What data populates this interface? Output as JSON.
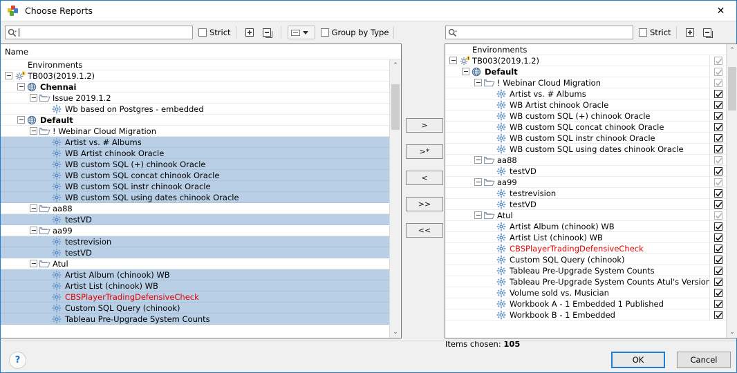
{
  "window": {
    "title": "Choose Reports",
    "close_label": "✕",
    "app_icon": "tableau-reports-icon"
  },
  "left_toolbar": {
    "search_placeholder": "",
    "search_value": "",
    "search_icon": "search-icon",
    "strict_label": "Strict",
    "strict_checked": false,
    "expand_all_icon": "expand-all-icon",
    "collapse_all_icon": "collapse-all-icon",
    "group_combo_icon": "group-level-icon",
    "group_by_type_label": "Group by Type",
    "group_by_type_checked": false
  },
  "right_toolbar": {
    "search_placeholder": "",
    "search_value": "",
    "search_icon": "search-icon",
    "strict_label": "Strict",
    "strict_checked": false,
    "expand_all_icon": "expand-all-icon",
    "collapse_all_icon": "collapse-all-icon"
  },
  "left_panel": {
    "column_header": "Name",
    "rows": [
      {
        "label": "Environments",
        "depth": 0,
        "icon": "none",
        "expander": "none",
        "selected": false,
        "bold": false,
        "red": false
      },
      {
        "label": "TB003(2019.1.2)",
        "depth": 0,
        "icon": "server",
        "expander": "minus",
        "selected": false,
        "bold": false,
        "red": false
      },
      {
        "label": "Chennai",
        "depth": 1,
        "icon": "site",
        "expander": "minus",
        "selected": false,
        "bold": true,
        "red": false
      },
      {
        "label": "Issue 2019.1.2",
        "depth": 2,
        "icon": "folder",
        "expander": "minus",
        "selected": false,
        "bold": false,
        "red": false
      },
      {
        "label": "Wb based on Postgres - embedded",
        "depth": 3,
        "icon": "workbook",
        "expander": "none",
        "selected": false,
        "bold": false,
        "red": false
      },
      {
        "label": "Default",
        "depth": 1,
        "icon": "site",
        "expander": "minus",
        "selected": false,
        "bold": true,
        "red": false
      },
      {
        "label": "! Webinar Cloud Migration",
        "depth": 2,
        "icon": "folder",
        "expander": "minus",
        "selected": false,
        "bold": false,
        "red": false
      },
      {
        "label": "Artist vs. # Albums",
        "depth": 3,
        "icon": "workbook",
        "expander": "none",
        "selected": true,
        "bold": false,
        "red": false
      },
      {
        "label": "WB Artist chinook Oracle",
        "depth": 3,
        "icon": "workbook",
        "expander": "none",
        "selected": true,
        "bold": false,
        "red": false
      },
      {
        "label": "WB custom SQL (+) chinook Oracle",
        "depth": 3,
        "icon": "workbook",
        "expander": "none",
        "selected": true,
        "bold": false,
        "red": false
      },
      {
        "label": "WB custom SQL concat chinook Oracle",
        "depth": 3,
        "icon": "workbook",
        "expander": "none",
        "selected": true,
        "bold": false,
        "red": false
      },
      {
        "label": "WB custom SQL instr chinook Oracle",
        "depth": 3,
        "icon": "workbook",
        "expander": "none",
        "selected": true,
        "bold": false,
        "red": false
      },
      {
        "label": "WB custom SQL using dates chinook Oracle",
        "depth": 3,
        "icon": "workbook",
        "expander": "none",
        "selected": true,
        "bold": false,
        "red": false
      },
      {
        "label": "aa88",
        "depth": 2,
        "icon": "folder",
        "expander": "minus",
        "selected": false,
        "bold": false,
        "red": false
      },
      {
        "label": "testVD",
        "depth": 3,
        "icon": "workbook",
        "expander": "none",
        "selected": true,
        "bold": false,
        "red": false
      },
      {
        "label": "aa99",
        "depth": 2,
        "icon": "folder",
        "expander": "minus",
        "selected": false,
        "bold": false,
        "red": false
      },
      {
        "label": "testrevision",
        "depth": 3,
        "icon": "workbook",
        "expander": "none",
        "selected": true,
        "bold": false,
        "red": false
      },
      {
        "label": "testVD",
        "depth": 3,
        "icon": "workbook",
        "expander": "none",
        "selected": true,
        "bold": false,
        "red": false
      },
      {
        "label": "Atul",
        "depth": 2,
        "icon": "folder",
        "expander": "minus",
        "selected": false,
        "bold": false,
        "red": false
      },
      {
        "label": "Artist Album (chinook) WB",
        "depth": 3,
        "icon": "workbook",
        "expander": "none",
        "selected": true,
        "bold": false,
        "red": false
      },
      {
        "label": "Artist List (chinook) WB",
        "depth": 3,
        "icon": "workbook",
        "expander": "none",
        "selected": true,
        "bold": false,
        "red": false
      },
      {
        "label": "CBSPlayerTradingDefensiveCheck",
        "depth": 3,
        "icon": "workbook",
        "expander": "none",
        "selected": true,
        "bold": false,
        "red": true
      },
      {
        "label": "Custom SQL  Query (chinook)",
        "depth": 3,
        "icon": "workbook",
        "expander": "none",
        "selected": true,
        "bold": false,
        "red": false
      },
      {
        "label": "Tableau Pre-Upgrade System Counts",
        "depth": 3,
        "icon": "workbook",
        "expander": "none",
        "selected": true,
        "bold": false,
        "red": false
      }
    ],
    "scrollbar": {
      "up_arrow": "⌃",
      "down_arrow": "⌄",
      "thumb_top_pct": 5,
      "thumb_height_pct": 18
    }
  },
  "right_panel": {
    "rows": [
      {
        "label": "Environments",
        "depth": 0,
        "icon": "none",
        "expander": "none",
        "checkbox": "none",
        "red": false,
        "bold": false
      },
      {
        "label": "TB003(2019.1.2)",
        "depth": 0,
        "icon": "server",
        "expander": "minus",
        "checkbox": "dim",
        "red": false,
        "bold": false
      },
      {
        "label": "Default",
        "depth": 1,
        "icon": "site",
        "expander": "minus",
        "checkbox": "dim",
        "red": false,
        "bold": true
      },
      {
        "label": "! Webinar Cloud Migration",
        "depth": 2,
        "icon": "folder",
        "expander": "minus",
        "checkbox": "dim",
        "red": false,
        "bold": false
      },
      {
        "label": "Artist vs. # Albums",
        "depth": 3,
        "icon": "workbook",
        "expander": "none",
        "checkbox": "checked",
        "red": false,
        "bold": false
      },
      {
        "label": "WB Artist chinook Oracle",
        "depth": 3,
        "icon": "workbook",
        "expander": "none",
        "checkbox": "checked",
        "red": false,
        "bold": false
      },
      {
        "label": "WB custom SQL (+) chinook Oracle",
        "depth": 3,
        "icon": "workbook",
        "expander": "none",
        "checkbox": "checked",
        "red": false,
        "bold": false
      },
      {
        "label": "WB custom SQL concat chinook Oracle",
        "depth": 3,
        "icon": "workbook",
        "expander": "none",
        "checkbox": "checked",
        "red": false,
        "bold": false
      },
      {
        "label": "WB custom SQL instr chinook Oracle",
        "depth": 3,
        "icon": "workbook",
        "expander": "none",
        "checkbox": "checked",
        "red": false,
        "bold": false
      },
      {
        "label": "WB custom SQL using dates chinook Oracle",
        "depth": 3,
        "icon": "workbook",
        "expander": "none",
        "checkbox": "checked",
        "red": false,
        "bold": false
      },
      {
        "label": "aa88",
        "depth": 2,
        "icon": "folder",
        "expander": "minus",
        "checkbox": "dim",
        "red": false,
        "bold": false
      },
      {
        "label": "testVD",
        "depth": 3,
        "icon": "workbook",
        "expander": "none",
        "checkbox": "checked",
        "red": false,
        "bold": false
      },
      {
        "label": "aa99",
        "depth": 2,
        "icon": "folder",
        "expander": "minus",
        "checkbox": "dim",
        "red": false,
        "bold": false
      },
      {
        "label": "testrevision",
        "depth": 3,
        "icon": "workbook",
        "expander": "none",
        "checkbox": "checked",
        "red": false,
        "bold": false
      },
      {
        "label": "testVD",
        "depth": 3,
        "icon": "workbook",
        "expander": "none",
        "checkbox": "checked",
        "red": false,
        "bold": false
      },
      {
        "label": "Atul",
        "depth": 2,
        "icon": "folder",
        "expander": "minus",
        "checkbox": "dim",
        "red": false,
        "bold": false
      },
      {
        "label": "Artist Album (chinook) WB",
        "depth": 3,
        "icon": "workbook",
        "expander": "none",
        "checkbox": "checked",
        "red": false,
        "bold": false
      },
      {
        "label": "Artist List (chinook) WB",
        "depth": 3,
        "icon": "workbook",
        "expander": "none",
        "checkbox": "checked",
        "red": false,
        "bold": false
      },
      {
        "label": "CBSPlayerTradingDefensiveCheck",
        "depth": 3,
        "icon": "workbook",
        "expander": "none",
        "checkbox": "checked",
        "red": true,
        "bold": false
      },
      {
        "label": "Custom SQL  Query (chinook)",
        "depth": 3,
        "icon": "workbook",
        "expander": "none",
        "checkbox": "checked",
        "red": false,
        "bold": false
      },
      {
        "label": "Tableau Pre-Upgrade System Counts",
        "depth": 3,
        "icon": "workbook",
        "expander": "none",
        "checkbox": "checked",
        "red": false,
        "bold": false
      },
      {
        "label": "Tableau Pre-Upgrade System Counts Atul's Version",
        "depth": 3,
        "icon": "workbook",
        "expander": "none",
        "checkbox": "checked",
        "red": false,
        "bold": false
      },
      {
        "label": "Volume sold vs. Musician",
        "depth": 3,
        "icon": "workbook",
        "expander": "none",
        "checkbox": "checked",
        "red": false,
        "bold": false
      },
      {
        "label": "Workbook A - 1 Embedded 1 Published",
        "depth": 3,
        "icon": "workbook",
        "expander": "none",
        "checkbox": "checked",
        "red": false,
        "bold": false
      },
      {
        "label": "Workbook B - 1 Embedded",
        "depth": 3,
        "icon": "workbook",
        "expander": "none",
        "checkbox": "checked",
        "red": false,
        "bold": false
      }
    ],
    "scrollbar": {
      "up_arrow": "⌃",
      "down_arrow": "⌄",
      "thumb_top_pct": 4,
      "thumb_height_pct": 16
    }
  },
  "transfer_buttons": [
    {
      "label": ">",
      "name": "move-right-button"
    },
    {
      "label": ">*",
      "name": "move-right-recursive-button"
    },
    {
      "label": "<",
      "name": "move-left-button"
    },
    {
      "label": ">>",
      "name": "move-all-right-button"
    },
    {
      "label": "<<",
      "name": "move-all-left-button"
    }
  ],
  "status": {
    "items_chosen_label": "Items chosen:",
    "items_chosen_count": "105"
  },
  "footer": {
    "help_label": "?",
    "ok_label": "OK",
    "cancel_label": "Cancel"
  },
  "colors": {
    "accent": "#1f7fd4",
    "selection": "#b9cfe6",
    "error_text": "#e60000"
  }
}
